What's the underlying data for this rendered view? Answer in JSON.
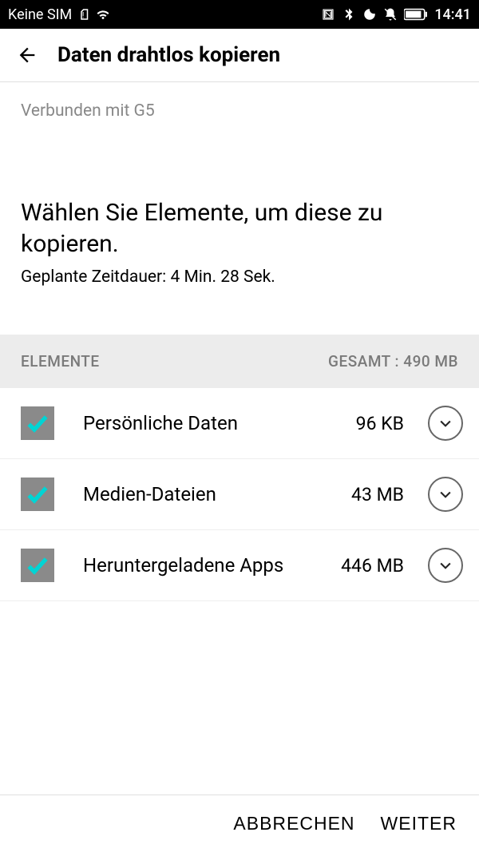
{
  "statusBar": {
    "carrier": "Keine SIM",
    "time": "14:41"
  },
  "header": {
    "title": "Daten drahtlos kopieren"
  },
  "connection": "Verbunden mit G5",
  "mainHeading": "Wählen Sie Elemente, um diese zu kopieren.",
  "duration": "Geplante Zeitdauer: 4 Min. 28 Sek.",
  "listHeader": {
    "left": "ELEMENTE",
    "right": "GESAMT : 490 MB"
  },
  "items": [
    {
      "label": "Persönliche Daten",
      "size": "96 KB",
      "checked": true
    },
    {
      "label": "Medien-Dateien",
      "size": "43 MB",
      "checked": true
    },
    {
      "label": "Heruntergeladene Apps",
      "size": "446 MB",
      "checked": true
    }
  ],
  "footer": {
    "cancel": "ABBRECHEN",
    "next": "WEITER"
  }
}
